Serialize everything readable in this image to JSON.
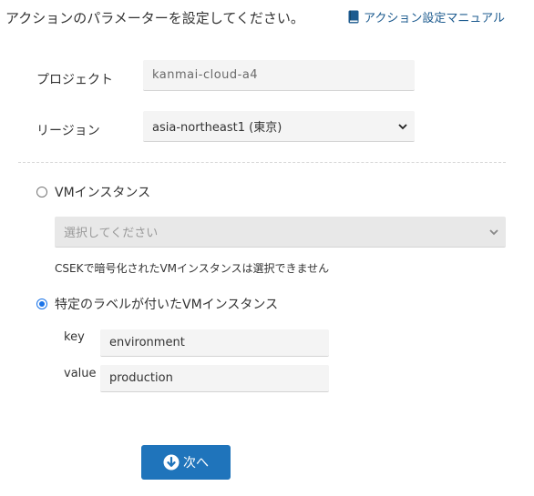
{
  "header": {
    "instruction": "アクションのパラメーターを設定してください。",
    "manual_link": "アクション設定マニュアル"
  },
  "form": {
    "project_label": "プロジェクト",
    "project_value": "kanmai-cloud-a4",
    "region_label": "リージョン",
    "region_value": "asia-northeast1 (東京)"
  },
  "options": {
    "vm_instance_label": "VMインスタンス",
    "vm_instance_placeholder": "選択してください",
    "csek_note": "CSEKで暗号化されたVMインスタンスは選択できません",
    "labeled_vm_label": "特定のラベルが付いたVMインスタンス",
    "selected": "labeled_vm"
  },
  "label_filter": {
    "key_label": "key",
    "key_value": "environment",
    "value_label": "value",
    "value_value": "production"
  },
  "actions": {
    "next_label": "次へ"
  },
  "colors": {
    "accent": "#1f74bb",
    "radio_checked": "#1a73e8",
    "link": "#1d5b8f",
    "field_bg": "#f4f4f4"
  },
  "icons": {
    "manual": "book-icon",
    "select": "chevron-down-icon",
    "next": "circle-arrow-down-icon"
  }
}
